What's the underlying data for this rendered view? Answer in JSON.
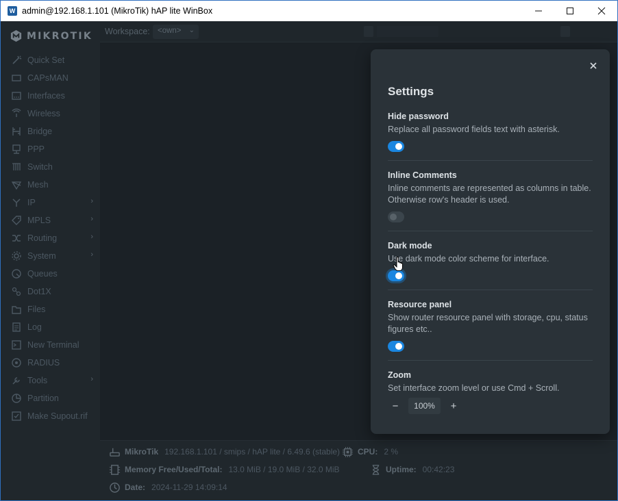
{
  "window": {
    "title": "admin@192.168.1.101 (MikroTik) hAP lite WinBox",
    "controls": [
      "minimize-icon",
      "maximize-icon",
      "close-icon"
    ]
  },
  "brand": {
    "logo_text": "MIKROTIK"
  },
  "sidebar": {
    "items": [
      {
        "label": "Quick Set",
        "icon": "wand-icon",
        "submenu": false
      },
      {
        "label": "CAPsMAN",
        "icon": "capsman-icon",
        "submenu": false
      },
      {
        "label": "Interfaces",
        "icon": "interfaces-icon",
        "submenu": false
      },
      {
        "label": "Wireless",
        "icon": "wireless-icon",
        "submenu": false
      },
      {
        "label": "Bridge",
        "icon": "bridge-icon",
        "submenu": false
      },
      {
        "label": "PPP",
        "icon": "ppp-icon",
        "submenu": false
      },
      {
        "label": "Switch",
        "icon": "switch-icon",
        "submenu": false
      },
      {
        "label": "Mesh",
        "icon": "mesh-icon",
        "submenu": false
      },
      {
        "label": "IP",
        "icon": "ip-icon",
        "submenu": true
      },
      {
        "label": "MPLS",
        "icon": "tag-icon",
        "submenu": true
      },
      {
        "label": "Routing",
        "icon": "routing-icon",
        "submenu": true
      },
      {
        "label": "System",
        "icon": "gear-icon",
        "submenu": true
      },
      {
        "label": "Queues",
        "icon": "queues-icon",
        "submenu": false
      },
      {
        "label": "Dot1X",
        "icon": "dot1x-icon",
        "submenu": false
      },
      {
        "label": "Files",
        "icon": "folder-icon",
        "submenu": false
      },
      {
        "label": "Log",
        "icon": "log-icon",
        "submenu": false
      },
      {
        "label": "New Terminal",
        "icon": "terminal-icon",
        "submenu": false
      },
      {
        "label": "RADIUS",
        "icon": "radius-icon",
        "submenu": false
      },
      {
        "label": "Tools",
        "icon": "tools-icon",
        "submenu": true
      },
      {
        "label": "Partition",
        "icon": "partition-icon",
        "submenu": false
      },
      {
        "label": "Make Supout.rif",
        "icon": "supout-icon",
        "submenu": false
      }
    ]
  },
  "topbar": {
    "workspace_label": "Workspace:",
    "workspace_value": "<own>"
  },
  "settings": {
    "title": "Settings",
    "close_icon": "close-icon",
    "hide_password": {
      "title": "Hide password",
      "description": "Replace all password fields text with asterisk.",
      "enabled": true
    },
    "inline_comments": {
      "title": "Inline Comments",
      "description": "Inline comments are represented as columns in table. Otherwise row's header is used.",
      "enabled": false
    },
    "dark_mode": {
      "title": "Dark mode",
      "description": "Use dark mode color scheme for interface.",
      "enabled": true
    },
    "resource_panel": {
      "title": "Resource panel",
      "description": "Show router resource panel with storage, cpu, status figures etc..",
      "enabled": true
    },
    "zoom": {
      "title": "Zoom",
      "description": "Set interface zoom level or use Cmd + Scroll.",
      "minus_label": "−",
      "value": "100%",
      "plus_label": "+"
    }
  },
  "status": {
    "router_name": "MikroTik",
    "router_info": "192.168.1.101 / smips / hAP lite / 6.49.6 (stable)",
    "cpu_label": "CPU:",
    "cpu_value": "2 %",
    "memory_label": "Memory Free/Used/Total:",
    "memory_value": "13.0 MiB / 19.0 MiB / 32.0 MiB",
    "uptime_label": "Uptime:",
    "uptime_value": "00:42:23",
    "date_label": "Date:",
    "date_value": "2024-11-29 14:09:14"
  },
  "colors": {
    "accent": "#1a86e0",
    "background": "#1b2126",
    "panel": "#2a3238",
    "sidebar_text": "#4c5862"
  }
}
